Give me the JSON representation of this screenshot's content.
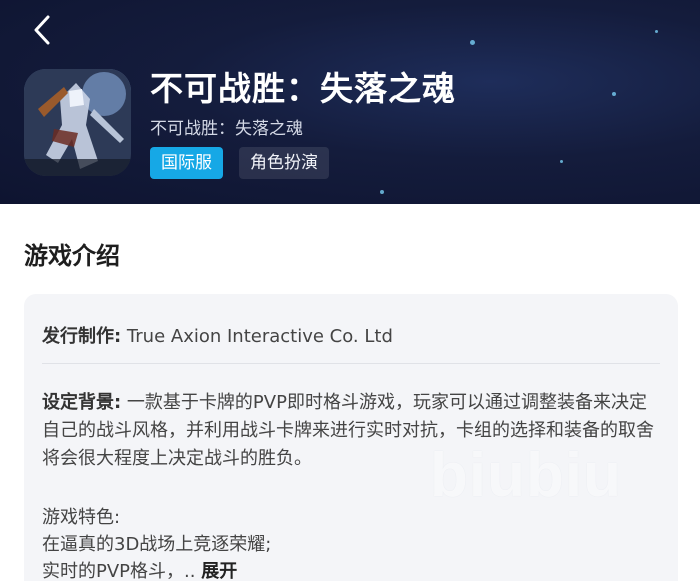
{
  "header": {
    "title": "不可战胜：失落之魂",
    "subtitle": "不可战胜：失落之魂",
    "tags": [
      {
        "label": "国际服",
        "color": "#16a8e6"
      },
      {
        "label": "角色扮演"
      }
    ]
  },
  "intro": {
    "section_title": "游戏介绍",
    "publisher_label": "发行制作:",
    "publisher_value": " True Axion Interactive Co. Ltd",
    "background_label": "设定背景:",
    "background_text": " 一款基于卡牌的PVP即时格斗游戏，玩家可以通过调整装备来决定自己的战斗风格，并利用战斗卡牌来进行实时对抗，卡组的选择和装备的取舍将会很大程度上决定战斗的胜负。",
    "features_heading": "游戏特色:",
    "features": [
      "在逼真的3D战场上竞逐荣耀;",
      "实时的PVP格斗，.."
    ],
    "expand_label": "展开"
  },
  "watermark": "biubiu"
}
